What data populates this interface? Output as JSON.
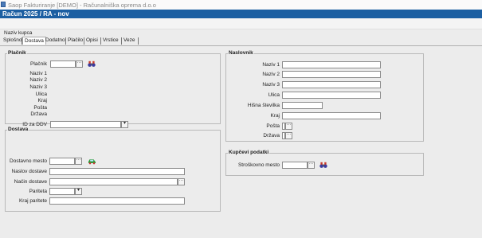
{
  "window": {
    "title": "Saop Fakturiranje [DEMO] - Računalniška oprema d.o.o"
  },
  "header": {
    "title": "Račun  2025 / RA - nov"
  },
  "customer": {
    "label": "Naziv kupca"
  },
  "tabs": [
    {
      "label": "Splošno",
      "active": false
    },
    {
      "label": "Dostava",
      "active": true
    },
    {
      "label": "Dodatno",
      "active": false
    },
    {
      "label": "Plačilo",
      "active": false
    },
    {
      "label": "Opisi",
      "active": false
    },
    {
      "label": "Vrstice",
      "active": false
    },
    {
      "label": "Veze",
      "active": false
    }
  ],
  "placnik": {
    "legend": "Plačnik",
    "field_label": "Plačnik",
    "info_labels": [
      "Naziv 1",
      "Naziv 2",
      "Naziv 3",
      "Ulica",
      "Kraj",
      "Pošta",
      "Država"
    ],
    "ddv_label": "ID za DDV",
    "search_icon": "binoculars-icon"
  },
  "naslovnik": {
    "legend": "Naslovnik",
    "fields": [
      "Naziv 1",
      "Naziv 2",
      "Naziv 3",
      "Ulica",
      "Hišna številka",
      "Kraj",
      "Pošta",
      "Država"
    ]
  },
  "dostava": {
    "legend": "Dostava",
    "fields": [
      "Dostavno mesto",
      "Naslov dostave",
      "Način dostave",
      "Pariteta",
      "Kraj paritete"
    ],
    "car_icon": "delivery-car-icon"
  },
  "kupcevi": {
    "legend": "Kupčevi podatki",
    "field_label": "Stroškovno mesto",
    "search_icon": "binoculars-icon"
  },
  "colors": {
    "header_bg": "#1c5fa2",
    "page_bg": "#ececec"
  }
}
